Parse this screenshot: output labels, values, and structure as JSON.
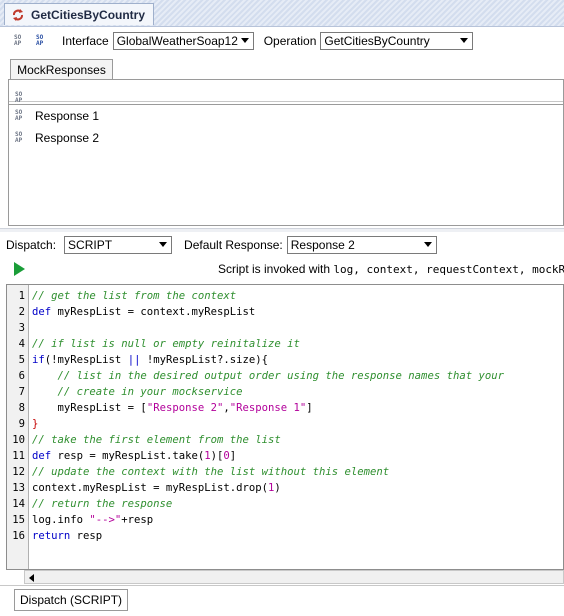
{
  "window": {
    "title": "GetCitiesByCountry"
  },
  "toolbar": {
    "interface_label": "Interface",
    "interface_value": "GlobalWeatherSoap12",
    "operation_label": "Operation",
    "operation_value": "GetCitiesByCountry"
  },
  "mock": {
    "tab_label": "MockResponses",
    "responses": [
      "Response 1",
      "Response 2"
    ]
  },
  "dispatch": {
    "label": "Dispatch:",
    "value": "SCRIPT",
    "default_label": "Default Response:",
    "default_value": "Response 2"
  },
  "script": {
    "info_prefix": "Script is invoked with ",
    "info_vars": "log, context, requestContext, mockRec"
  },
  "code": [
    "// get the list from the context",
    "def myRespList = context.myRespList",
    "",
    "// if list is null or empty reinitalize it",
    "if(!myRespList || !myRespList?.size){",
    "    // list in the desired output order using the response names that your",
    "    // create in your mockservice",
    "    myRespList = [\"Response 2\",\"Response 1\"]",
    "}",
    "// take the first element from the list",
    "def resp = myRespList.take(1)[0]",
    "// update the context with the list without this element",
    "context.myRespList = myRespList.drop(1)",
    "// return the response",
    "log.info \"-->\"+resp",
    "return resp"
  ],
  "bottom_tab": "Dispatch (SCRIPT)",
  "colors": {
    "comment": "#2f8f2f",
    "keyword": "#0000c8",
    "string": "#b2009a",
    "run": "#1a9d38"
  }
}
